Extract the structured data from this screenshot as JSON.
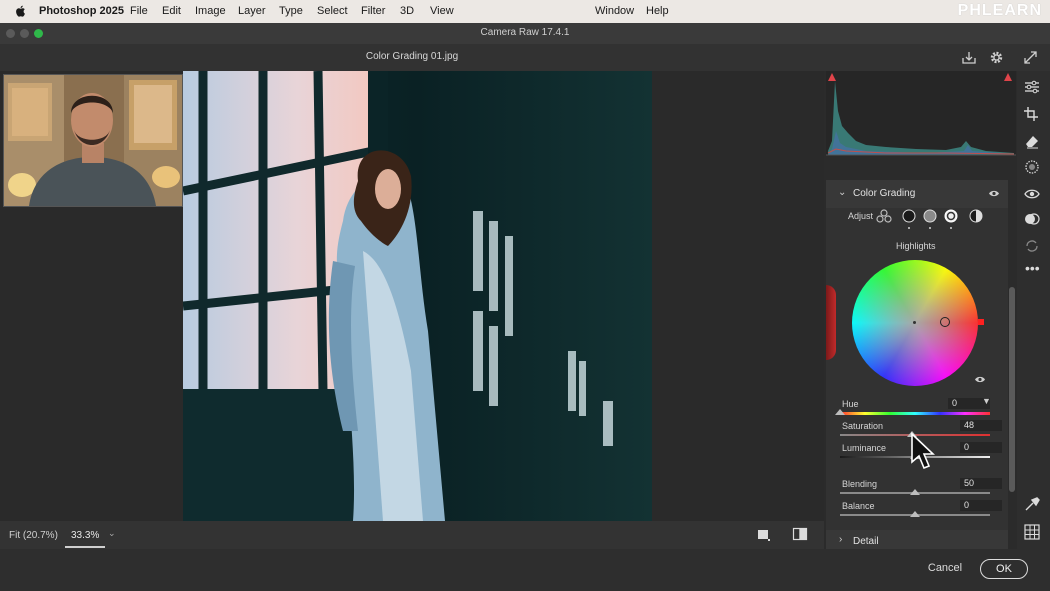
{
  "menu": {
    "app": "Photoshop 2025",
    "items": [
      "File",
      "Edit",
      "Image",
      "Layer",
      "Type",
      "Select",
      "Filter",
      "3D",
      "View",
      "Window",
      "Help"
    ],
    "brand": "PHLEARN"
  },
  "window": {
    "title": "Camera Raw 17.4.1",
    "document": "Color Grading 01.jpg"
  },
  "zoom": {
    "fit": "Fit (20.7%)",
    "value": "33.3%"
  },
  "panel": {
    "section": "Color Grading",
    "adjust_label": "Adjust",
    "range": "Highlights",
    "sliders": {
      "hue": {
        "label": "Hue",
        "value": "0",
        "position": 0.0
      },
      "saturation": {
        "label": "Saturation",
        "value": "48",
        "position": 0.48
      },
      "luminance": {
        "label": "Luminance",
        "value": "0",
        "position": 0.5
      },
      "blending": {
        "label": "Blending",
        "value": "50",
        "position": 0.5
      },
      "balance": {
        "label": "Balance",
        "value": "0",
        "position": 0.5
      }
    },
    "next_section": "Detail"
  },
  "footer": {
    "cancel": "Cancel",
    "ok": "OK"
  },
  "colors": {
    "accent": "#e8e8e8",
    "panel_bg": "#323232",
    "clip_warning": "#e0444a"
  }
}
